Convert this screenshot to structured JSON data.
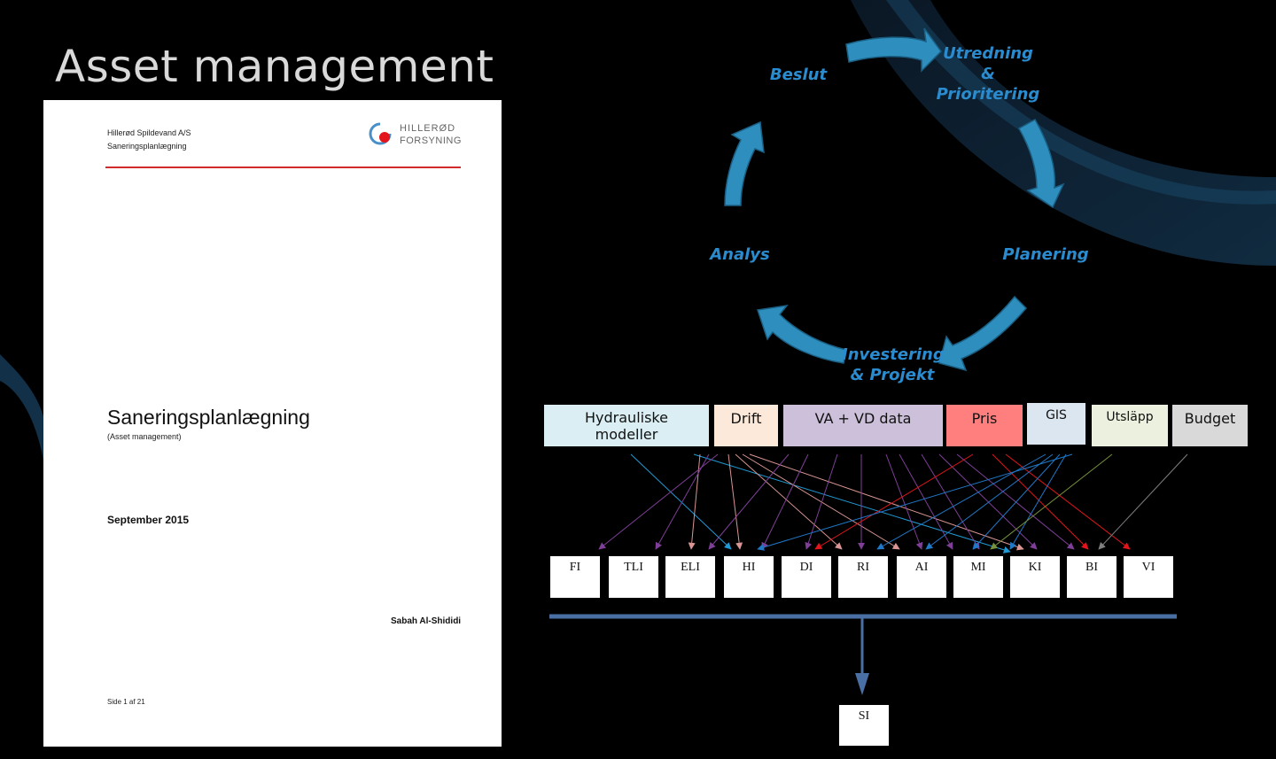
{
  "slide_title": "Asset management",
  "document": {
    "company": "Hillerød Spildevand A/S",
    "subtitle_small": "Saneringsplanlægning",
    "logo_line1": "HILLERØD",
    "logo_line2": "FORSYNING",
    "main_title": "Saneringsplanlægning",
    "paren": "(Asset management)",
    "date": "September 2015",
    "author": "Sabah Al-Shididi",
    "page": "Side 1 af 21",
    "accent_color": "#d12b2b"
  },
  "cycle": {
    "arrow_color": "#2e8fbf",
    "text_color": "#2a8ccf",
    "steps": {
      "beslut": "Beslut",
      "utredning_1": "Utredning",
      "utredning_2": "&",
      "utredning_3": "Prioritering",
      "planering": "Planering",
      "investering_1": "Investering",
      "investering_2": "& Projekt",
      "analys": "Analys"
    }
  },
  "sources": {
    "hydrauliske_1": "Hydrauliske",
    "hydrauliske_2": "modeller",
    "drift": "Drift",
    "va_vd": "VA + VD data",
    "pris": "Pris",
    "gis": "GIS",
    "utslapp": "Utsläpp",
    "budget": "Budget"
  },
  "source_colors": {
    "hydrauliske": "#daeef3",
    "drift": "#fde9d9",
    "va_vd": "#ccc0da",
    "pris": "#ff7f7f",
    "gis": "#dce6f1",
    "utslapp": "#ebf1de",
    "budget": "#d9d9d9"
  },
  "indices": [
    "FI",
    "TLI",
    "ELI",
    "HI",
    "DI",
    "RI",
    "AI",
    "MI",
    "KI",
    "BI",
    "VI"
  ],
  "result": "SI",
  "bar_color": "#4a6fa5"
}
